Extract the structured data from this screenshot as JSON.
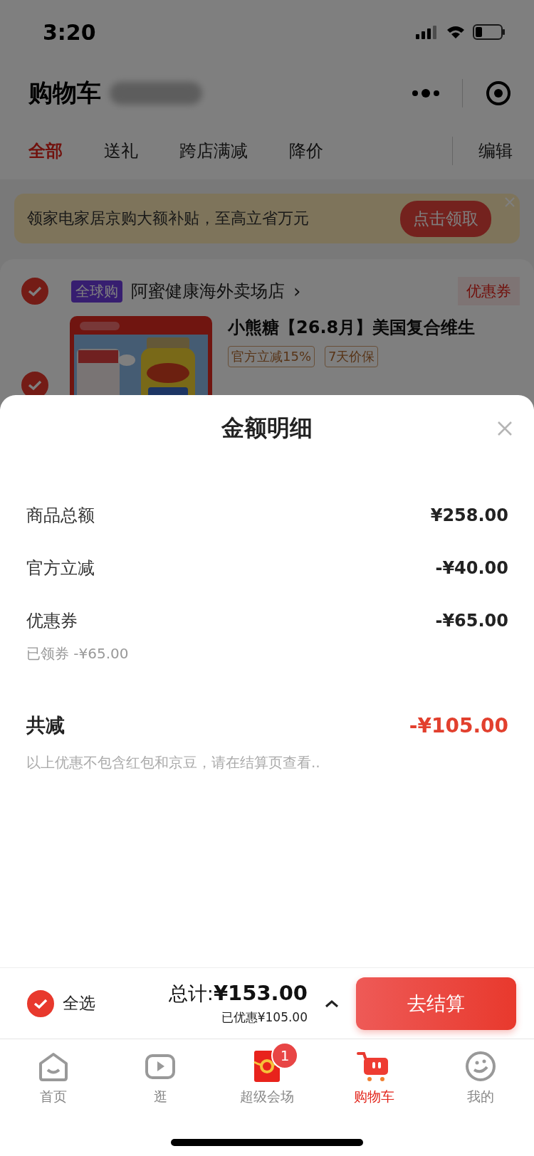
{
  "status_bar": {
    "time": "3:20"
  },
  "header": {
    "title": "购物车"
  },
  "tabs": [
    {
      "label": "全部",
      "selected": true
    },
    {
      "label": "送礼",
      "selected": false
    },
    {
      "label": "跨店满减",
      "selected": false
    },
    {
      "label": "降价",
      "selected": false
    }
  ],
  "edit_button": "编辑",
  "banner": {
    "text": "领家电家居京购大额补贴，至高立省万元",
    "button": "点击领取"
  },
  "store": {
    "checked": true,
    "badge": "全球购",
    "name": "阿蜜健康海外卖场店",
    "arrow": "›",
    "coupon": "优惠券"
  },
  "product": {
    "checked": true,
    "kind": "picture",
    "title": "小熊糖【26.8月】美国复合维生",
    "tags": [
      "官方立减15%",
      "7天价保"
    ]
  },
  "sheet": {
    "title": "金额明细",
    "rows": [
      {
        "label": "商品总额",
        "amount": "¥258.00"
      },
      {
        "label": "官方立减",
        "amount": "-¥40.00"
      },
      {
        "label": "优惠券",
        "amount": "-¥65.00",
        "sub": "已领券 -¥65.00"
      }
    ],
    "total": {
      "label": "共减",
      "amount": "-¥105.00"
    },
    "note": "以上优惠不包含红包和京豆，请在结算页查看.."
  },
  "checkout": {
    "select_all": {
      "label": "全选",
      "checked": true
    },
    "total_label": "总计:",
    "total": "¥153.00",
    "saved": "已优惠¥105.00",
    "button": "去结算"
  },
  "nav": [
    {
      "label": "首页",
      "selected": false
    },
    {
      "label": "逛",
      "selected": false
    },
    {
      "label": "超级会场",
      "selected": false,
      "badge": "1"
    },
    {
      "label": "购物车",
      "selected": true
    },
    {
      "label": "我的",
      "selected": false
    }
  ]
}
